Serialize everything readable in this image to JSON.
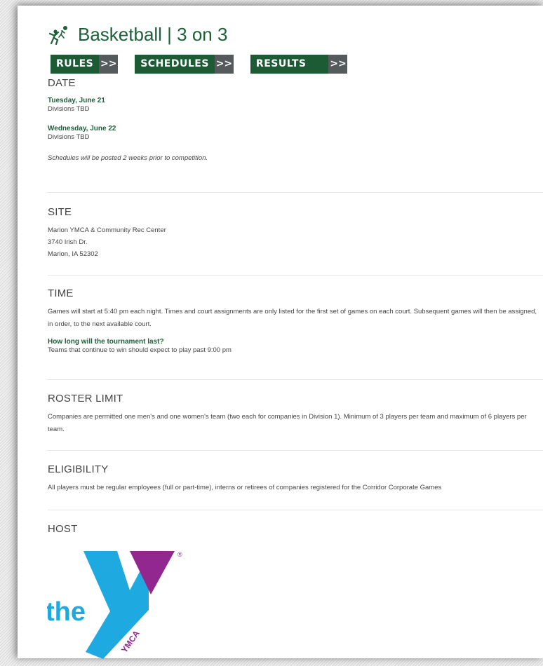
{
  "title": "Basketball | 3 on 3",
  "nav": [
    {
      "label": "RULES",
      "arrow": ">>"
    },
    {
      "label": "SCHEDULES",
      "arrow": ">>"
    },
    {
      "label": "RESULTS",
      "arrow": ">>"
    }
  ],
  "date": {
    "heading": "DATE",
    "entries": [
      {
        "day": "Tuesday, June 21",
        "divisions": "Divisions TBD"
      },
      {
        "day": "Wednesday, June 22",
        "divisions": "Divisions TBD"
      }
    ],
    "note": "Schedules will be posted 2 weeks prior to competition."
  },
  "site": {
    "heading": "SITE",
    "lines": [
      "Marion YMCA & Community Rec Center",
      "3740 Irish Dr.",
      "Marion, IA 52302"
    ]
  },
  "time": {
    "heading": "TIME",
    "body": "Games will start at 5:40 pm each night.  Times and court assignments are only listed for the first set of games on each court. Subsequent games will then be assigned, in order, to the next available court.",
    "question": "How long will the tournament last?",
    "answer": "Teams that continue to win should expect to play past 9:00 pm"
  },
  "roster": {
    "heading": "ROSTER LIMIT",
    "body": "Companies are permitted one men's and one women's team (two each for companies in Division 1).  Minimum of 3 players per team and maximum of 6 players per team."
  },
  "eligibility": {
    "heading": "ELIGIBILITY",
    "body": "All players must be regular employees (full or part-time), interns or retirees of companies registered for the Corridor Corporate Games"
  },
  "host": {
    "heading": "HOST",
    "logo_word": "the",
    "logo_mark": "YMCA",
    "logo_registered": "®"
  },
  "colors": {
    "brand_green": "#1d5b35",
    "arrow_gray": "#555a5c",
    "ymca_blue": "#1fa9e1",
    "ymca_purple": "#92278f"
  }
}
